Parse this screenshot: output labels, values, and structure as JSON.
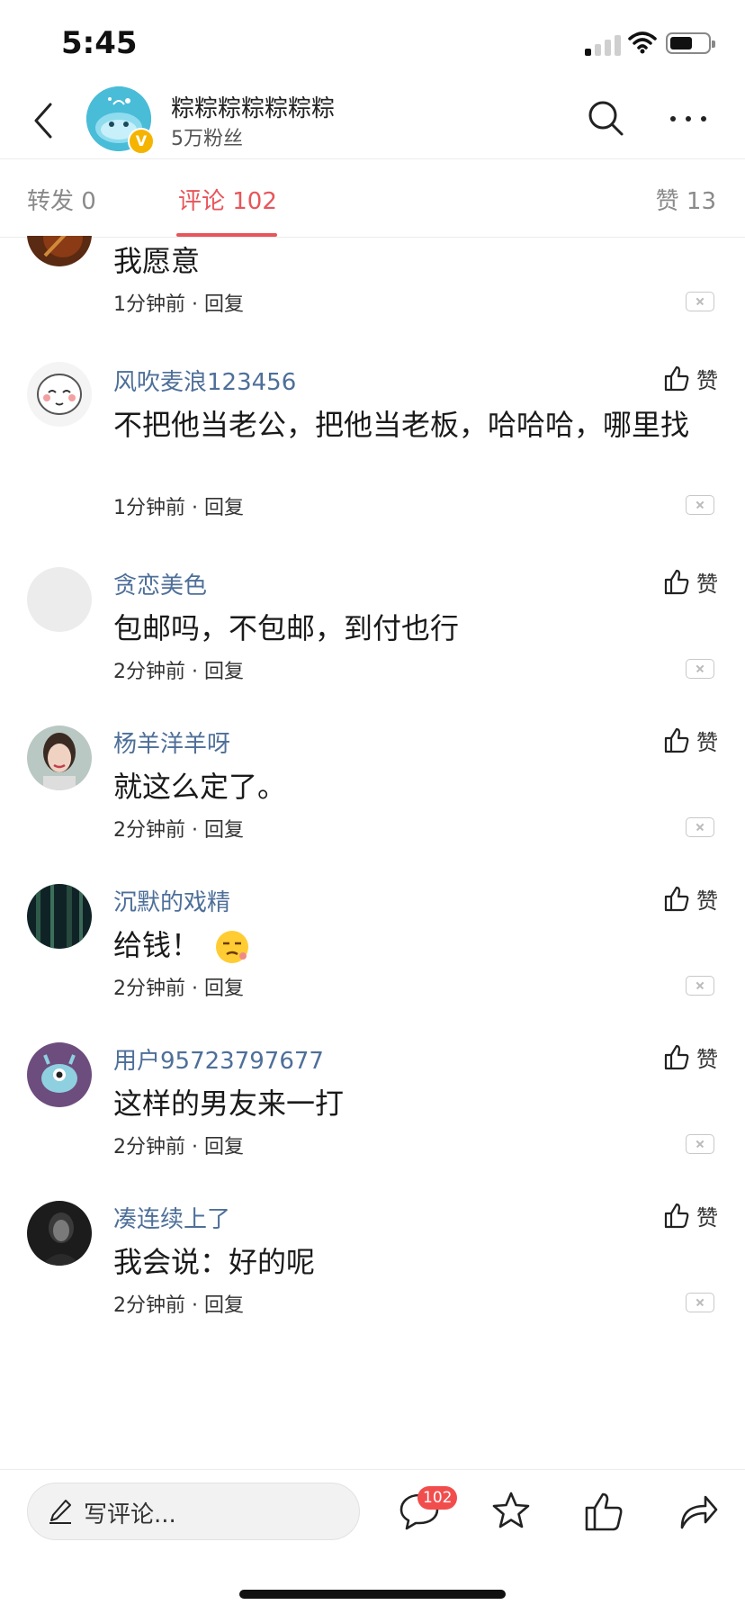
{
  "status_bar": {
    "time": "5:45"
  },
  "header": {
    "name": "粽粽粽粽粽粽粽",
    "fans": "5万粉丝",
    "verified_mark": "V"
  },
  "tabs": {
    "repost": "转发 0",
    "comments": "评论 102",
    "likes": "赞 13"
  },
  "comments": [
    {
      "name": "",
      "text": "我愿意",
      "meta": "1分钟前 · 回复",
      "like_label": ""
    },
    {
      "name": "风吹麦浪123456",
      "text": "不把他当老公，把他当老板，哈哈哈，哪里找",
      "meta": "1分钟前 · 回复",
      "like_label": "赞"
    },
    {
      "name": "贪恋美色",
      "text": "包邮吗，不包邮，到付也行",
      "meta": "2分钟前 · 回复",
      "like_label": "赞"
    },
    {
      "name": "杨羊洋羊呀",
      "text": "就这么定了。",
      "meta": "2分钟前 · 回复",
      "like_label": "赞"
    },
    {
      "name": "沉默的戏精",
      "text": "给钱！",
      "meta": "2分钟前 · 回复",
      "like_label": "赞",
      "emoji": "smirk-emoji"
    },
    {
      "name": "用户95723797677",
      "text": "这样的男友来一打",
      "meta": "2分钟前 · 回复",
      "like_label": "赞"
    },
    {
      "name": "凑连续上了",
      "text": "我会说：好的呢",
      "meta": "2分钟前 · 回复",
      "like_label": "赞"
    }
  ],
  "bottom_bar": {
    "placeholder": "写评论...",
    "comment_count": "102"
  },
  "colors": {
    "accent": "#e8555a",
    "username": "#4e6f99",
    "badge": "#f24d4d"
  },
  "icons": [
    "back-icon",
    "search-icon",
    "more-icon",
    "like-icon",
    "dismiss-icon",
    "pen-icon",
    "comment-icon",
    "star-icon",
    "thumb-up-icon",
    "share-icon"
  ]
}
